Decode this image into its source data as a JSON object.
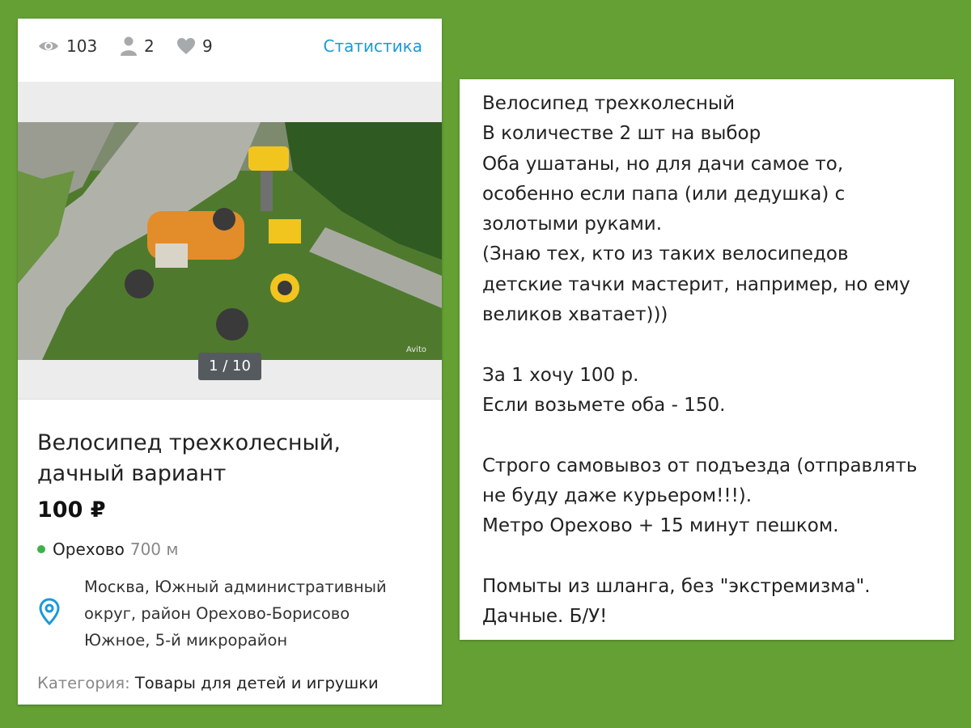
{
  "stats": {
    "views": "103",
    "contacts": "2",
    "favorites": "9",
    "link_label": "Статистика",
    "link_color": "#1a9ad6"
  },
  "gallery": {
    "counter": "1 / 10",
    "watermark": "Avito"
  },
  "listing": {
    "title_lines": [
      "Велосипед трехколесный,",
      "дачный вариант"
    ],
    "price": "100 ₽",
    "metro": {
      "station": "Орехово",
      "distance": "700 м",
      "dot_color": "#3cb34a"
    },
    "address_lines": [
      "Москва, Южный административный",
      "округ, район Орехово-Борисово",
      "Южное, 5-й микрорайон"
    ],
    "category_label": "Категория:",
    "category_value": "Товары для детей и игрушки"
  },
  "description": {
    "lines": [
      "Велосипед трехколесный",
      "В количестве 2 шт на выбор",
      "Оба ушатаны, но для дачи самое то,",
      "особенно если папа (или дедушка) с",
      "золотыми руками.",
      "(Знаю тех, кто из таких велосипедов",
      "детские тачки мастерит, например, но ему",
      "великов хватает)))",
      "",
      "За 1 хочу 100 р.",
      "Если возьмете оба - 150.",
      "",
      "Строго самовывоз от подъезда (отправлять",
      "не буду даже курьером!!!).",
      "Метро Орехово + 15 минут пешком.",
      "",
      "Помыты из шланга, без \"экстремизма\".",
      "Дачные. Б/У!"
    ]
  },
  "icons": {
    "views": "eye-icon",
    "contacts": "person-icon",
    "favorites": "heart-icon",
    "address": "location-pin-icon"
  },
  "colors": {
    "background": "#64a033",
    "accent": "#1a9ad6"
  }
}
